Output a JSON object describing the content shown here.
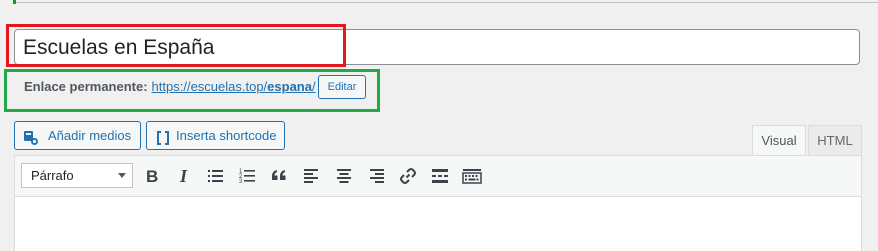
{
  "post_title": {
    "value": "Escuelas en España"
  },
  "permalink": {
    "label": "Enlace permanente:",
    "url_base": "https://escuelas.top/",
    "slug": "espana",
    "url_suffix": "/",
    "edit_label": "Editar"
  },
  "media_buttons": {
    "add_media": "Añadir medios",
    "insert_shortcode": "Inserta shortcode"
  },
  "editor_tabs": {
    "visual": "Visual",
    "html": "HTML"
  },
  "toolbar": {
    "format_selected": "Párrafo",
    "buttons": [
      "bold-icon",
      "italic-icon",
      "bullet-list-icon",
      "numbered-list-icon",
      "blockquote-icon",
      "align-left-icon",
      "align-center-icon",
      "align-right-icon",
      "link-icon",
      "read-more-icon",
      "toolbar-toggle-icon"
    ]
  },
  "colors": {
    "accent": "#2271b1",
    "title_highlight": "#e4161e",
    "permalink_highlight": "#24a745"
  }
}
